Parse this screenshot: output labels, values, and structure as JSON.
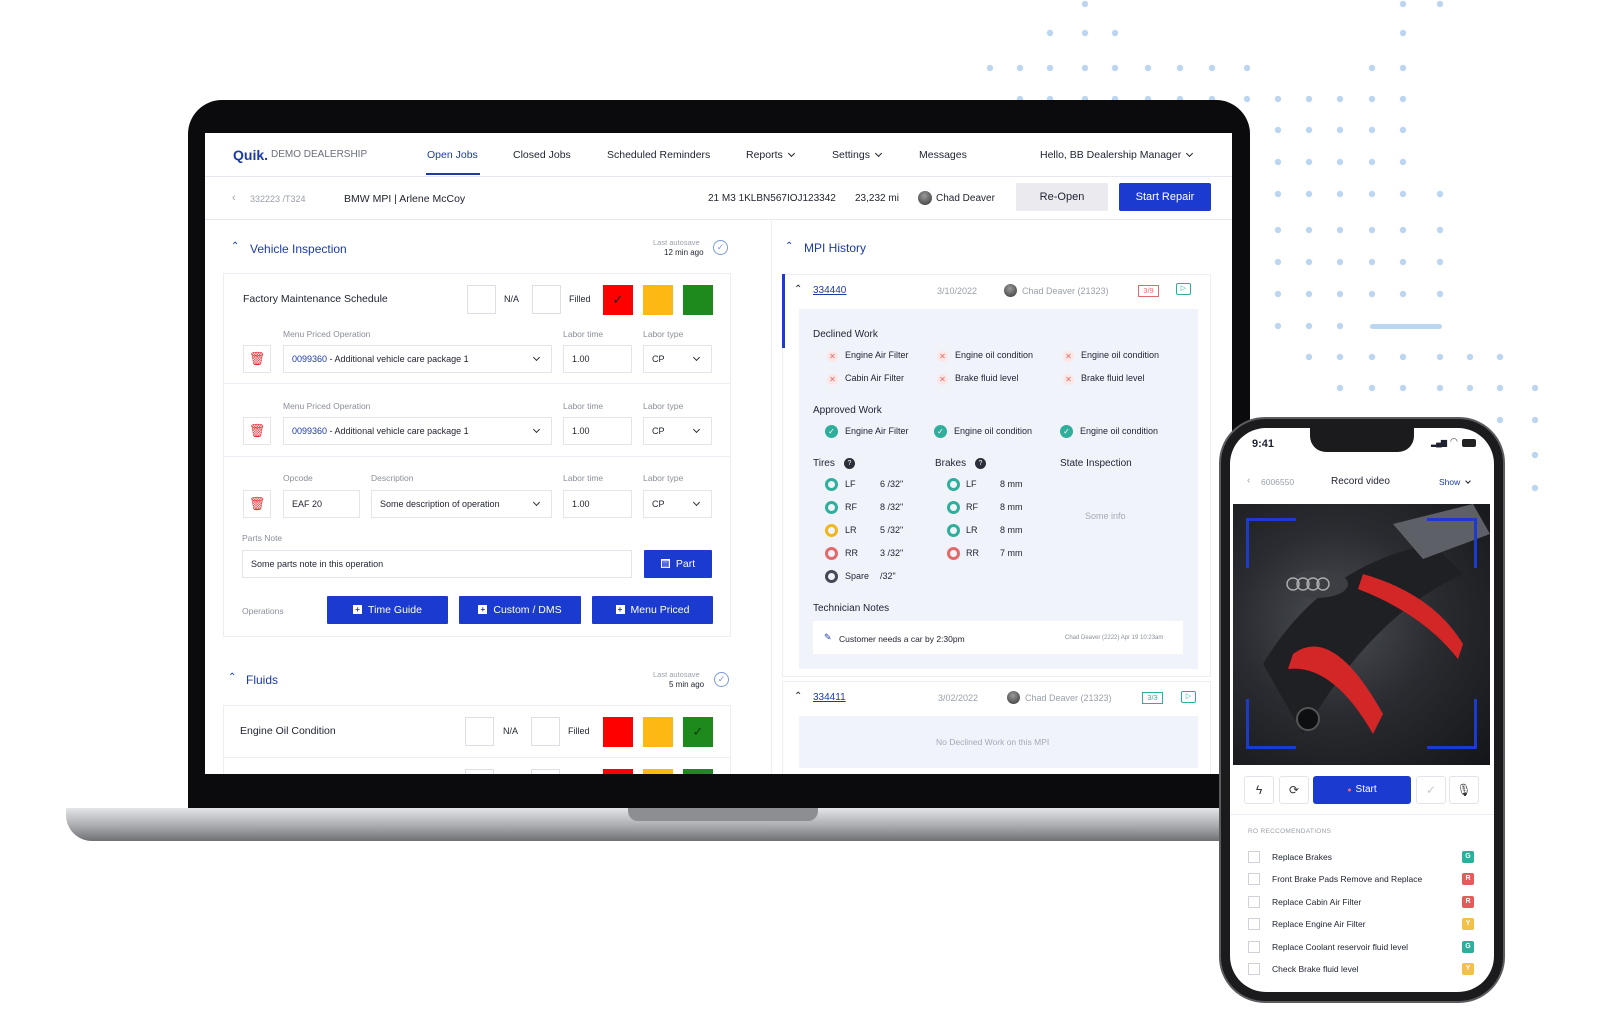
{
  "laptop": {
    "brand": "Quik.",
    "dealership": "DEMO DEALERSHIP",
    "nav": {
      "open_jobs": "Open Jobs",
      "closed_jobs": "Closed Jobs",
      "scheduled": "Scheduled Reminders",
      "reports": "Reports",
      "settings": "Settings",
      "messages": "Messages",
      "greeting": "Hello, BB Dealership Manager"
    },
    "job": {
      "ro": "332223 /T324",
      "title": "BMW MPI | Arlene McCoy",
      "vin": "21 M3 1KLBN567IOJ123342",
      "mileage": "23,232 mi",
      "tech": "Chad Deaver",
      "reopen": "Re-Open",
      "start_repair": "Start Repair"
    },
    "inspection": {
      "title": "Vehicle Inspection",
      "autosave_label": "Last autosave",
      "autosave_time": "12 min ago",
      "item_name": "Factory Maintenance Schedule",
      "na": "N/A",
      "filled": "Filled",
      "ops": [
        {
          "label": "Menu Priced Operation",
          "code": "0099360",
          "desc": " - Additional vehicle care package 1",
          "labor_label": "Labor time",
          "labor": "1.00",
          "type_label": "Labor type",
          "type": "CP"
        },
        {
          "label": "Menu Priced Operation",
          "code": "0099360",
          "desc": " - Additional vehicle care package 1",
          "labor_label": "Labor time",
          "labor": "1.00",
          "type_label": "Labor type",
          "type": "CP"
        }
      ],
      "op3": {
        "opcode_label": "Opcode",
        "opcode": "EAF 20",
        "desc_label": "Description",
        "desc": "Some description of operation",
        "labor_label": "Labor time",
        "labor": "1.00",
        "type_label": "Labor type",
        "type": "CP"
      },
      "parts_note_label": "Parts Note",
      "parts_note": "Some parts note in this operation",
      "part_btn": "Part",
      "operations_label": "Operations",
      "time_guide": "Time Guide",
      "custom_dms": "Custom / DMS",
      "menu_priced": "Menu Priced"
    },
    "fluids": {
      "title": "Fluids",
      "autosave_label": "Last autosave",
      "autosave_time": "5 min ago",
      "item_name": "Engine Oil Condition",
      "na": "N/A",
      "filled": "Filled"
    },
    "history": {
      "title": "MPI History",
      "entry1": {
        "id": "334440",
        "date": "3/10/2022",
        "tech": "Chad Deaver (21323)",
        "badge": "3/9",
        "declined_title": "Declined Work",
        "declined": [
          "Engine Air Filter",
          "Engine oil condition",
          "Engine oil condition",
          "Cabin Air Filter",
          "Brake fluid level",
          "Brake fluid level"
        ],
        "approved_title": "Approved Work",
        "approved": [
          "Engine Air Filter",
          "Engine oil condition",
          "Engine oil condition"
        ],
        "tires_title": "Tires",
        "tires": [
          {
            "pos": "LF",
            "val": "6 /32\"",
            "color": "#2eae9b"
          },
          {
            "pos": "RF",
            "val": "8 /32\"",
            "color": "#2eae9b"
          },
          {
            "pos": "LR",
            "val": "5 /32\"",
            "color": "#f2b51d"
          },
          {
            "pos": "RR",
            "val": "3 /32\"",
            "color": "#e36a6a"
          },
          {
            "pos": "Spare",
            "val": "/32\"",
            "color": "#444a55"
          }
        ],
        "brakes_title": "Brakes",
        "brakes": [
          {
            "pos": "LF",
            "val": "8 mm",
            "color": "#2eae9b"
          },
          {
            "pos": "RF",
            "val": "8 mm",
            "color": "#2eae9b"
          },
          {
            "pos": "LR",
            "val": "8 mm",
            "color": "#2eae9b"
          },
          {
            "pos": "RR",
            "val": "7 mm",
            "color": "#e36a6a"
          }
        ],
        "state_title": "State Inspection",
        "state_info": "Some info",
        "notes_title": "Technician Notes",
        "note": "Customer needs a car by 2:30pm",
        "note_meta": "Chad Deaver (2222) Apr 19 10:23am"
      },
      "entry2": {
        "id": "334411",
        "date": "3/02/2022",
        "tech": "Chad Deaver (21323)",
        "badge": "3/3",
        "empty": "No Declined Work on this MPI"
      }
    },
    "colors": {
      "red": "#ff0000",
      "yellow": "#fdb813",
      "green": "#1e8a1e",
      "primary": "#1b3ad0"
    }
  },
  "phone": {
    "time": "9:41",
    "ro": "6006550",
    "title": "Record video",
    "show": "Show",
    "start": "Start",
    "recs_title": "RO RECCOMENDATIONS",
    "recs": [
      {
        "label": "Replace Brakes",
        "tag": "G",
        "color": "#2eae9b"
      },
      {
        "label": "Front Brake Pads Remove and Replace",
        "tag": "R",
        "color": "#e45b5b"
      },
      {
        "label": "Replace Cabin Air Filter",
        "tag": "R",
        "color": "#e45b5b"
      },
      {
        "label": "Replace Engine Air Filter",
        "tag": "Y",
        "color": "#f2c14a"
      },
      {
        "label": "Replace Coolant reservoir fluid level",
        "tag": "G",
        "color": "#2eae9b"
      },
      {
        "label": "Check Brake fluid level",
        "tag": "Y",
        "color": "#f2c14a"
      }
    ]
  }
}
